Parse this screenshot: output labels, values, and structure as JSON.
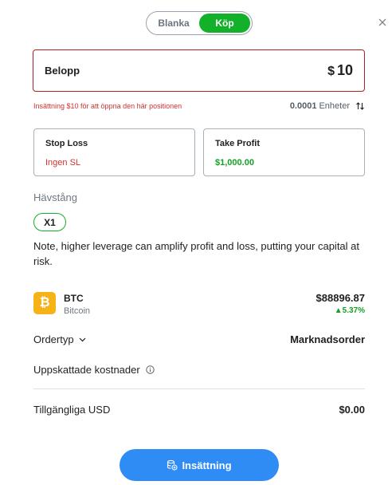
{
  "toggle": {
    "sell_label": "Blanka",
    "buy_label": "Köp"
  },
  "amount": {
    "label": "Belopp",
    "currency": "$",
    "value": "10"
  },
  "error_text": "Insättning $10 för att öppna den här positionen",
  "units": {
    "value": "0.0001",
    "label": "Enheter"
  },
  "stop_loss": {
    "title": "Stop Loss",
    "value": "Ingen SL"
  },
  "take_profit": {
    "title": "Take Profit",
    "value": "$1,000.00"
  },
  "leverage": {
    "title": "Hävstång",
    "value": "X1",
    "note": "Note, higher leverage can amplify profit and loss, putting your capital at risk."
  },
  "asset": {
    "icon_glyph": "₿",
    "symbol": "BTC",
    "name": "Bitcoin",
    "price": "$88896.87",
    "change": "5.37%"
  },
  "order": {
    "label": "Ordertyp",
    "value": "Marknadsorder"
  },
  "costs": {
    "label": "Uppskattade kostnader"
  },
  "available": {
    "label": "Tillgängliga USD",
    "value": "$0.00"
  },
  "deposit_button": {
    "label": "Insättning"
  },
  "colors": {
    "accent_green": "#13b129",
    "error_red": "#d0312d",
    "primary_blue": "#2f8cf5",
    "btc_orange": "#f5b317"
  }
}
